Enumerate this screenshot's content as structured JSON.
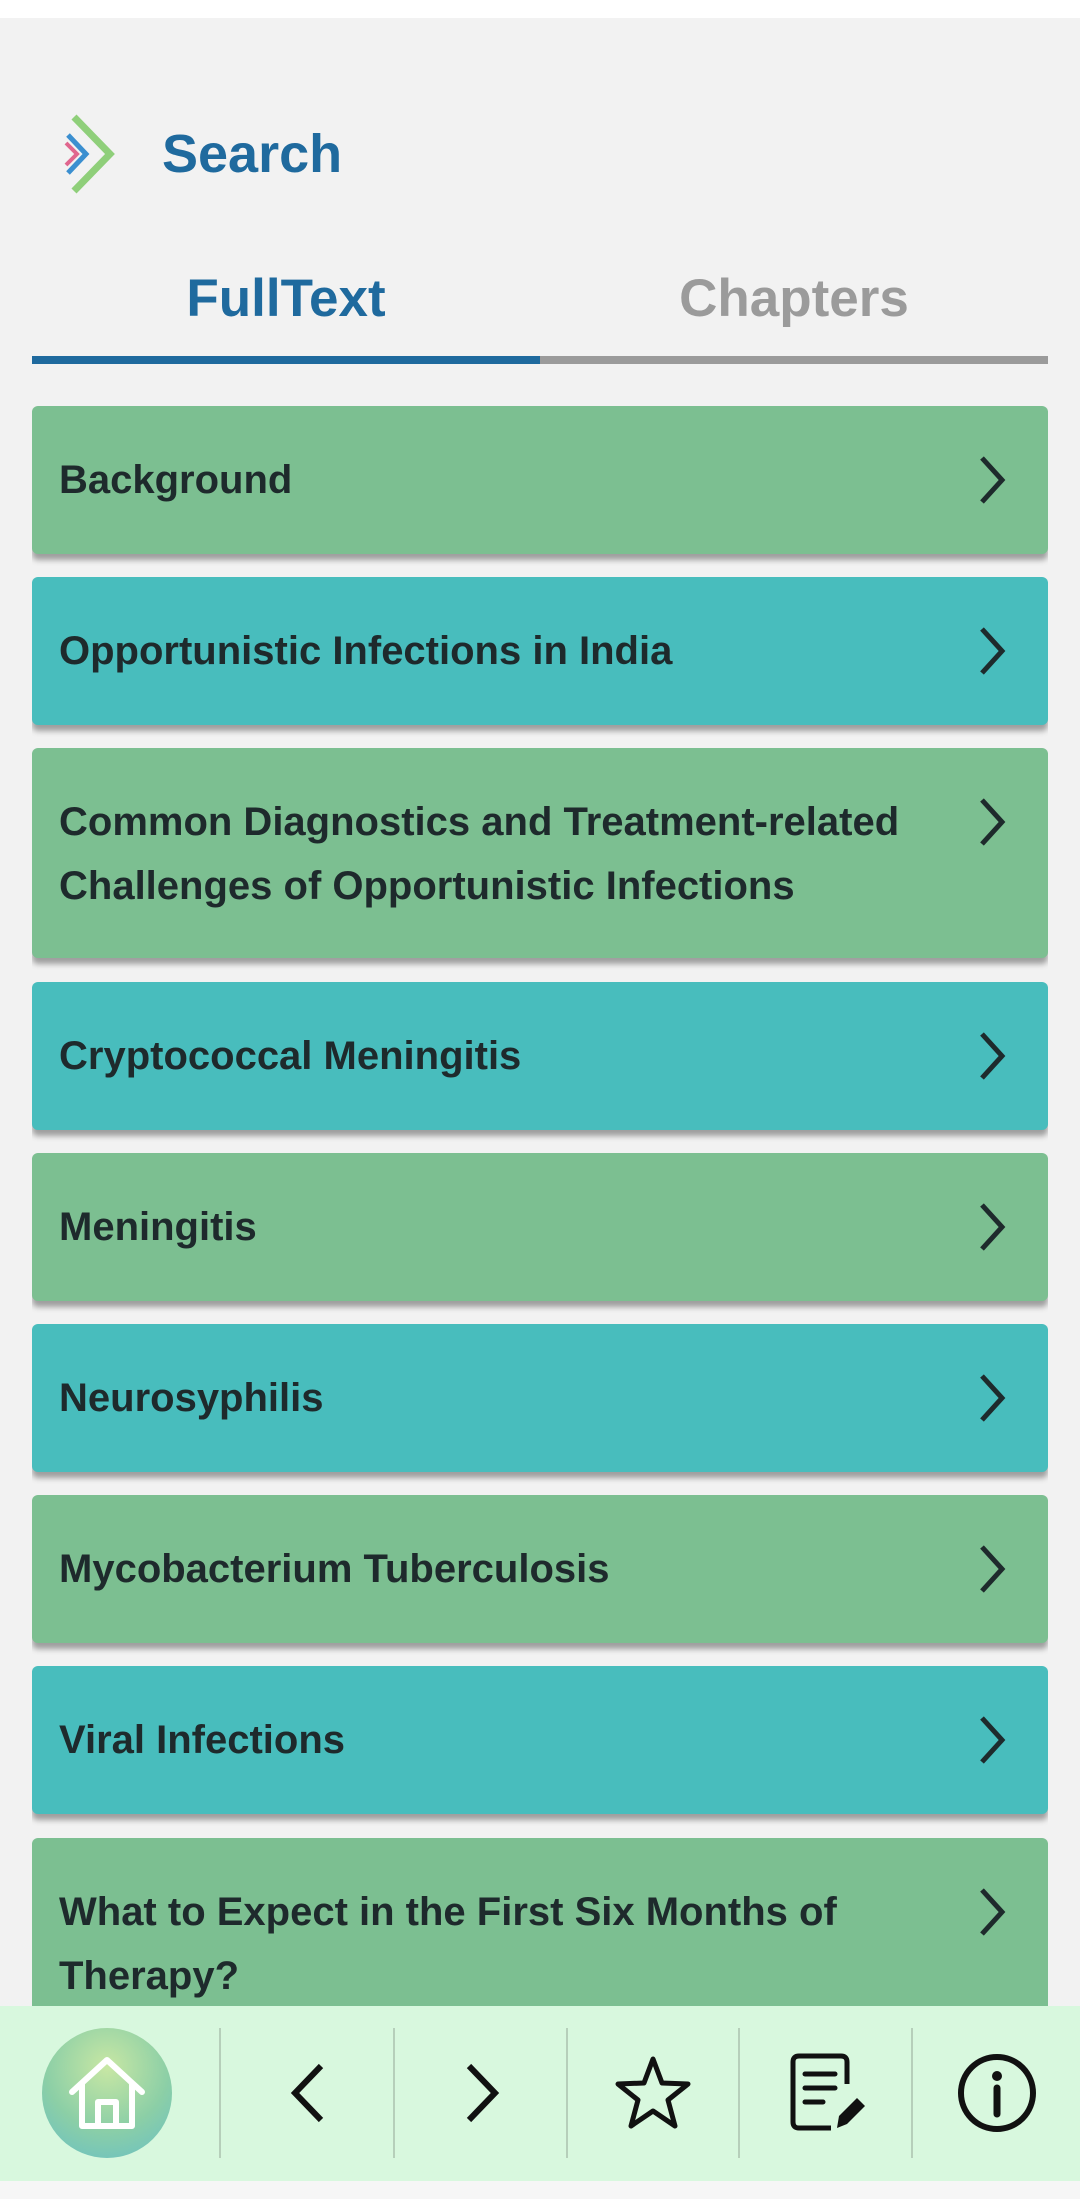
{
  "header": {
    "title": "Search",
    "logo_icon": "chevron-logo-icon"
  },
  "tabs": [
    {
      "label": "FullText",
      "active": true
    },
    {
      "label": "Chapters",
      "active": false
    }
  ],
  "items": [
    {
      "label": "Background",
      "color": "#7cbf91"
    },
    {
      "label": "Opportunistic Infections in India",
      "color": "#48bdbd"
    },
    {
      "label": "Common Diagnostics and Treatment-related Challenges of Opportunistic Infections",
      "color": "#7cbf91"
    },
    {
      "label": "Cryptococcal Meningitis",
      "color": "#48bdbd"
    },
    {
      "label": "Meningitis",
      "color": "#7cbf91"
    },
    {
      "label": "Neurosyphilis",
      "color": "#48bdbd"
    },
    {
      "label": "Mycobacterium Tuberculosis",
      "color": "#7cbf91"
    },
    {
      "label": "Viral Infections",
      "color": "#48bdbd"
    },
    {
      "label": "What to Expect in the First Six Months of Therapy?",
      "color": "#7cbf91"
    }
  ],
  "bottom_nav": [
    {
      "icon": "home-icon"
    },
    {
      "icon": "chevron-left-icon"
    },
    {
      "icon": "chevron-right-icon"
    },
    {
      "icon": "star-icon"
    },
    {
      "icon": "notes-edit-icon"
    },
    {
      "icon": "info-icon"
    }
  ],
  "colors": {
    "accent": "#1f6a9e",
    "inactive_tab": "#9b9b9b",
    "card_green": "#7cbf91",
    "card_teal": "#48bdbd",
    "bottom_bar": "#d8f8de"
  }
}
